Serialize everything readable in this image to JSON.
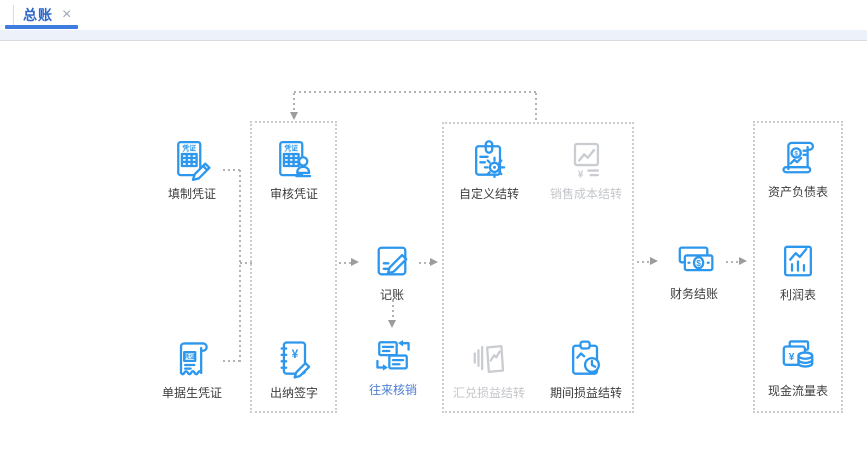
{
  "tab": {
    "label": "总账"
  },
  "glyphs": {
    "close": "×",
    "voucher_text": "凭证",
    "yen": "¥",
    "dollar": "$"
  },
  "colors": {
    "icon_blue": "#2d97ee",
    "label_dark": "#3d3d3d",
    "disabled_gray": "#c3c6ca",
    "active_link_blue": "#4e80d4",
    "tab_text_blue": "#2a66cc",
    "tab_indicator_blue": "#3e7de0",
    "toolbar_strip_bg": "#edf2fa",
    "connector_gray": "#b3b3b3"
  },
  "nodes": {
    "fill_voucher": {
      "label": "填制凭证",
      "state": "normal"
    },
    "audit_voucher": {
      "label": "审核凭证",
      "state": "normal"
    },
    "doc_to_voucher": {
      "label": "单据生凭证",
      "state": "normal"
    },
    "cashier_sign": {
      "label": "出纳签字",
      "state": "normal"
    },
    "bookkeeping": {
      "label": "记账",
      "state": "normal"
    },
    "transaction_writeoff": {
      "label": "往来核销",
      "state": "active"
    },
    "custom_carryover": {
      "label": "自定义结转",
      "state": "normal"
    },
    "sales_cost_carryover": {
      "label": "销售成本结转",
      "state": "disabled"
    },
    "exchange_gain_loss_carryover": {
      "label": "汇兑损益结转",
      "state": "disabled"
    },
    "period_profit_loss_carryover": {
      "label": "期间损益结转",
      "state": "normal"
    },
    "financial_closing": {
      "label": "财务结账",
      "state": "normal"
    },
    "balance_sheet": {
      "label": "资产负债表",
      "state": "normal"
    },
    "income_statement": {
      "label": "利润表",
      "state": "normal"
    },
    "cash_flow_statement": {
      "label": "现金流量表",
      "state": "normal"
    }
  }
}
